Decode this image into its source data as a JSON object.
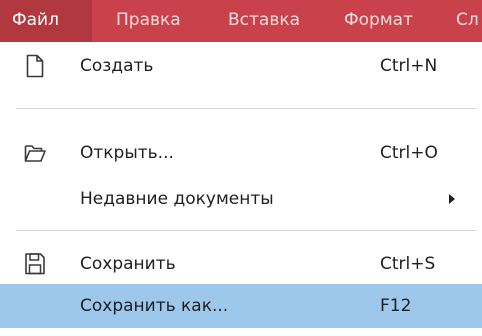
{
  "menubar": {
    "items": [
      {
        "label": "Файл"
      },
      {
        "label": "Правка"
      },
      {
        "label": "Вставка"
      },
      {
        "label": "Формат"
      },
      {
        "label": "Сл"
      }
    ]
  },
  "file_menu": {
    "items": [
      {
        "label": "Создать",
        "shortcut": "Ctrl+N",
        "icon": "new-document-icon"
      },
      {
        "label": "Открыть...",
        "shortcut": "Ctrl+O",
        "icon": "open-folder-icon"
      },
      {
        "label": "Недавние документы",
        "shortcut": "",
        "icon": ""
      },
      {
        "label": "Сохранить",
        "shortcut": "Ctrl+S",
        "icon": "save-disk-icon"
      },
      {
        "label": "Сохранить как...",
        "shortcut": "F12",
        "icon": ""
      }
    ],
    "highlighted_item": "Сохранить как..."
  },
  "colors": {
    "menubar_bg": "#c9414b",
    "menubar_active_bg": "#b23840",
    "menubar_text": "#f6dcdd",
    "highlight_bg": "#9ec7ec",
    "separator": "#d6d6d6"
  }
}
